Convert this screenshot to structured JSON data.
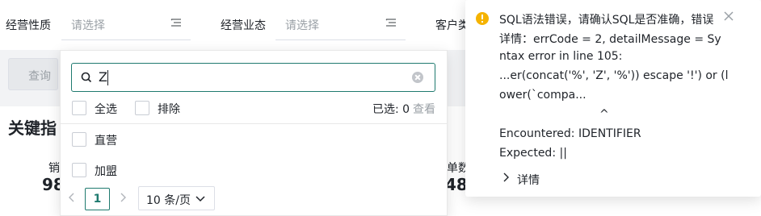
{
  "filters": [
    {
      "label": "经营性质",
      "placeholder": "请选择"
    },
    {
      "label": "经营业态",
      "placeholder": "请选择"
    },
    {
      "label": "客户类"
    }
  ],
  "query_button": "查询",
  "section_title": "关键指",
  "metrics": {
    "left_label_fragment": "销",
    "left_value_fragment": "98",
    "right_label_fragment": "单数",
    "right_value_fragment": "48"
  },
  "dropdown": {
    "search_value": "Z",
    "select_all": "全选",
    "exclude": "排除",
    "selected_count": "已选: 0",
    "view": "查看",
    "options": [
      "直营",
      "加盟"
    ],
    "pagination": {
      "current_page": "1",
      "page_size": "10 条/页"
    }
  },
  "notification": {
    "lines": [
      "SQL语法错误，请确认SQL是否准确，错误",
      "详情：errCode = 2, detailMessage = Sy",
      "ntax error in line 105:",
      "...er(concat('%', 'Z', '%')) escape '!') or (l",
      "ower(`compa...",
      "^",
      "Encountered: IDENTIFIER",
      "Expected: ||"
    ],
    "details_label": "详情"
  },
  "colors": {
    "accent": "#1f7a6f",
    "warning": "#f5b300"
  }
}
